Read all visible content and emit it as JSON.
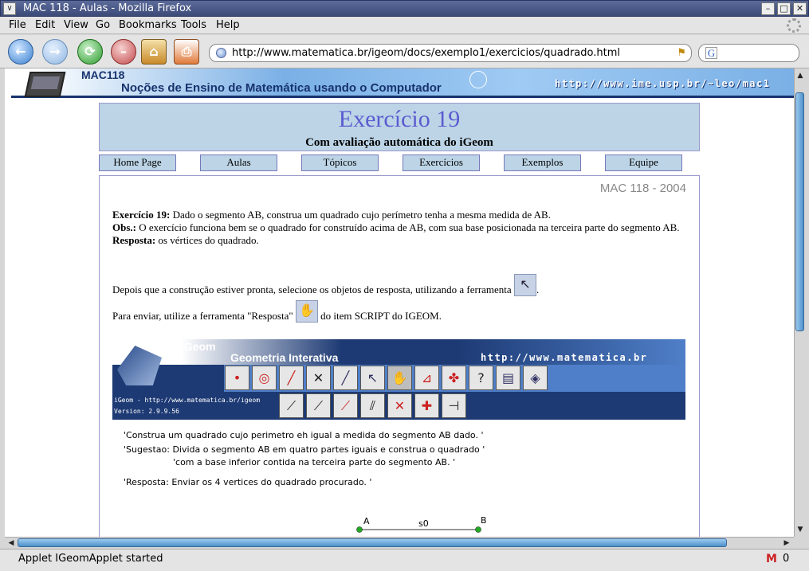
{
  "window": {
    "title": "MAC 118 - Aulas - Mozilla Firefox",
    "menu_glyph": "∨",
    "minimize_glyph": "–",
    "maximize_glyph": "□",
    "close_glyph": "✕"
  },
  "menubar": {
    "items": [
      "File",
      "Edit",
      "View",
      "Go",
      "Bookmarks",
      "Tools",
      "Help"
    ]
  },
  "toolbar": {
    "back_icon": "back-arrow-icon",
    "forward_icon": "forward-arrow-icon",
    "reload_icon": "reload-icon",
    "stop_icon": "stop-icon",
    "home_icon": "home-icon",
    "print_icon": "print-icon",
    "back_glyph": "←",
    "forward_glyph": "→",
    "reload_glyph": "⟳",
    "stop_glyph": "–",
    "home_glyph": "⌂",
    "print_glyph": "⎙",
    "url": "http://www.matematica.br/igeom/docs/exemplo1/exercicios/quadrado.html",
    "go_glyph": "⚑",
    "search_engine_letter": "G"
  },
  "site_banner": {
    "course": "MAC118",
    "subtitle": "Noções de Ensino de Matemática usando o Computador",
    "url": "http://www.ime.usp.br/~leo/mac1"
  },
  "exercise": {
    "title": "Exercício 19",
    "subtitle": "Com avaliação automática do iGeom"
  },
  "nav": {
    "items": [
      "Home Page",
      "Aulas",
      "Tópicos",
      "Exercícios",
      "Exemplos",
      "Equipe"
    ]
  },
  "content": {
    "course_year": "MAC 118 - 2004",
    "ex_label": "Exercício 19:",
    "ex_text": " Dado o segmento AB, construa um quadrado cujo perímetro tenha a mesma medida de AB.",
    "obs_label": "Obs.:",
    "obs_text": " O exercício funciona bem se o quadrado for construído acima de AB, com sua base posicionada na terceira parte do segmento AB.",
    "resp_label": "Resposta:",
    "resp_text": " os vértices do quadrado.",
    "select_text": "Depois que a construção estiver pronta, selecione os objetos de resposta, utilizando a ferramenta",
    "select_suffix": ".",
    "send_text_before": "Para enviar, utilize a ferramenta \"Resposta\"",
    "send_text_after": "do item SCRIPT do IGEOM.",
    "select_tool_glyph": "↖",
    "response_tool_glyph": "✋"
  },
  "applet": {
    "name": "iGeom",
    "tagline": "Geometria Interativa",
    "url": "http://www.matematica.br",
    "info_line1": "iGeom - http://www.matematica.br/igeom",
    "info_line2": "Version: 2.9.9.56",
    "row1_buttons": [
      "•",
      "◎",
      "╱",
      "✕",
      "╱",
      "↖",
      "✋",
      "⊿",
      "✤",
      "?",
      "▤",
      "◈"
    ],
    "row2_buttons": [
      "⟋",
      "⟋",
      "⟋",
      "⫽",
      "✕",
      "✚",
      "⊣"
    ],
    "messages": [
      "'Construa um quadrado cujo perimetro eh igual a medida do segmento AB dado.  '",
      "'Sugestao: Divida o segmento AB em quatro partes iguais e construa o quadrado '",
      "'com a base inferior contida na terceira parte do segmento AB.   '",
      "'Resposta: Enviar os 4 vertices do quadrado procurado.  '"
    ],
    "point_a": "A",
    "point_b": "B",
    "segment_label": "s0"
  },
  "scrollbars": {
    "up_glyph": "▲",
    "down_glyph": "▼",
    "left_glyph": "◀",
    "right_glyph": "▶"
  },
  "statusbar": {
    "text": "Applet IGeomApplet started",
    "mail_icon_letter": "M",
    "mail_count": "0"
  },
  "colors": {
    "banner_dark": "#17336e",
    "header_bg": "#bcd4e6",
    "title_color": "#5b5bd0",
    "applet_bg": "#1d3a74",
    "point_green": "#22aa22"
  }
}
